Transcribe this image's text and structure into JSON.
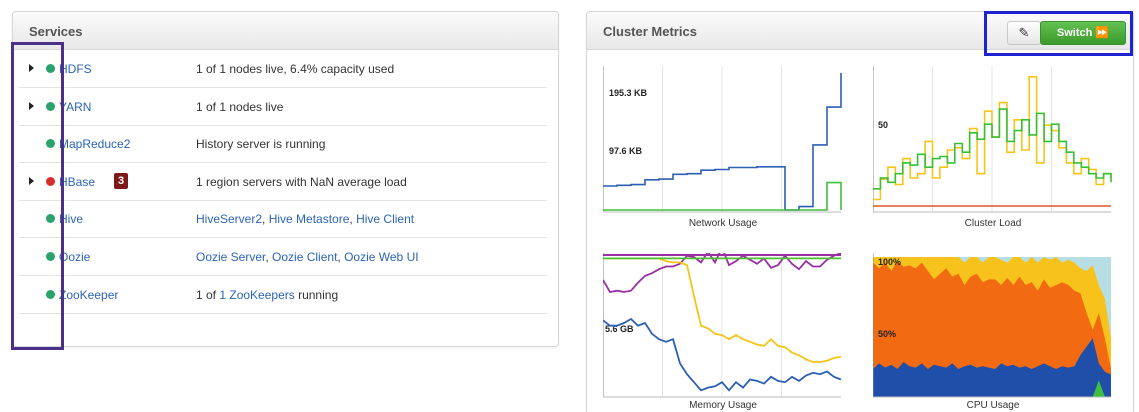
{
  "services_panel": {
    "title": "Services",
    "rows": [
      {
        "name": "HDFS",
        "status_text": "1 of 1 nodes live, 6.4% capacity used",
        "state": "green",
        "expandable": true
      },
      {
        "name": "YARN",
        "status_text": "1 of 1 nodes live",
        "state": "green",
        "expandable": true
      },
      {
        "name": "MapReduce2",
        "status_text": "History server is running",
        "state": "green",
        "expandable": false
      },
      {
        "name": "HBase",
        "alerts": "3",
        "status_text": "1 region servers with NaN average load",
        "state": "red",
        "expandable": true
      },
      {
        "name": "Hive",
        "links": [
          "HiveServer2",
          "Hive Metastore",
          "Hive Client"
        ],
        "link_separator": ", ",
        "state": "green",
        "expandable": false
      },
      {
        "name": "Oozie",
        "links": [
          "Oozie Server",
          "Oozie Client",
          "Oozie Web UI"
        ],
        "link_separator": ", ",
        "state": "green",
        "expandable": false
      },
      {
        "name": "ZooKeeper",
        "status_prefix": "1 of ",
        "status_link": "1 ZooKeepers",
        "status_suffix": " running",
        "state": "green",
        "expandable": false
      }
    ]
  },
  "metrics_panel": {
    "title": "Cluster Metrics",
    "edit_icon": "pencil-icon",
    "switch_label": "Switch ⏩"
  },
  "colors": {
    "status_green": "#2aa36a",
    "status_red": "#d62d2d",
    "link_blue": "#2b64b8",
    "switch_green": "#4bab3c",
    "services_highlight": "#4c2f86",
    "button_highlight": "#1f22d1",
    "net_blue": "#2d5fb5",
    "net_green": "#3fbf3f",
    "load_yellow": "#f5c518",
    "load_green": "#35c035",
    "load_red": "#e0552a",
    "mem_purple": "#9a2fa3",
    "mem_yellow": "#f5c518",
    "mem_blue": "#2d5fb5",
    "mem_green": "#4cbf30",
    "cpu_teal": "#b7dfe3",
    "cpu_yellow": "#f7c21b",
    "cpu_orange": "#f26b12",
    "cpu_blue": "#1f4fa8",
    "cpu_green": "#3fbf3f"
  },
  "chart_data": [
    {
      "type": "line",
      "title": "Network Usage",
      "y_tick_labels": [
        "195.3 KB",
        "97.6 KB"
      ],
      "series": [
        {
          "color": "#2d5fb5",
          "y": [
            35,
            36,
            37,
            44,
            45,
            52,
            53,
            58,
            59,
            62,
            62,
            63,
            63,
            0,
            5,
            95,
            150,
            200
          ]
        },
        {
          "color": "#3fbf3f",
          "y": [
            0,
            0,
            0,
            0,
            0,
            0,
            0,
            0,
            0,
            0,
            0,
            0,
            0,
            0,
            0,
            0,
            40,
            0
          ]
        }
      ]
    },
    {
      "type": "line",
      "title": "Cluster Load",
      "y_tick_labels": [
        "50"
      ],
      "series": [
        {
          "color": "#f5c518",
          "y": [
            6,
            25,
            36,
            20,
            44,
            26,
            30,
            60,
            26,
            36,
            52,
            54,
            44,
            72,
            30,
            88,
            64,
            96,
            50,
            80,
            52,
            120,
            40,
            75,
            70,
            54,
            40,
            30,
            44,
            34,
            20,
            30,
            26
          ]
        },
        {
          "color": "#35c035",
          "y": [
            16,
            26,
            22,
            30,
            40,
            38,
            48,
            36,
            44,
            46,
            40,
            58,
            50,
            68,
            62,
            76,
            64,
            90,
            60,
            70,
            80,
            66,
            86,
            60,
            76,
            60,
            50,
            40,
            36,
            30,
            26,
            30,
            22
          ]
        },
        {
          "color": "#e0552a",
          "y": [
            0,
            0,
            0,
            0,
            0,
            0,
            0,
            0,
            0,
            0,
            0,
            0,
            0,
            0,
            0,
            0,
            0,
            0,
            0,
            0,
            0,
            0,
            0,
            0,
            0,
            0,
            0,
            0,
            0,
            0,
            0,
            0,
            0
          ]
        }
      ]
    },
    {
      "type": "line",
      "title": "Memory Usage",
      "y_tick_labels": [
        "5.6 GB"
      ],
      "series": [
        {
          "color": "#9a2fa3",
          "y": [
            16,
            25,
            24,
            25,
            24,
            18,
            13,
            11,
            8,
            6,
            6,
            4,
            -2,
            -1,
            3,
            -5,
            3,
            -8,
            5,
            2,
            -2,
            1,
            4,
            0,
            7,
            5,
            -2,
            4,
            8,
            2,
            6,
            6,
            1,
            -2,
            -4
          ]
        },
        {
          "color": "#f5c518",
          "y": [
            0,
            0,
            0,
            0,
            0,
            0,
            0,
            0,
            0,
            2,
            3,
            3,
            5,
            28,
            50,
            52,
            56,
            57,
            60,
            57,
            60,
            62,
            64,
            65,
            60,
            65,
            66,
            70,
            72,
            75,
            77,
            77,
            76,
            74,
            73
          ]
        },
        {
          "color": "#2d5fb5",
          "y": [
            46,
            50,
            50,
            48,
            45,
            50,
            48,
            56,
            60,
            62,
            60,
            78,
            86,
            92,
            98,
            96,
            95,
            92,
            98,
            92,
            96,
            90,
            91,
            93,
            88,
            91,
            92,
            88,
            91,
            87,
            85,
            86,
            84,
            88,
            90
          ]
        },
        {
          "color": "#4cbf30",
          "y": [
            0,
            0,
            0,
            0,
            0,
            0,
            0,
            0,
            0,
            0,
            0,
            0,
            0,
            0,
            0,
            0,
            0,
            0,
            0,
            0,
            0,
            0,
            0,
            0,
            0,
            0,
            0,
            0,
            0,
            0,
            0,
            0,
            0,
            0,
            0
          ]
        }
      ]
    },
    {
      "type": "area",
      "title": "CPU Usage",
      "y_tick_labels": [
        "100%",
        "50%"
      ],
      "series": [
        {
          "color": "#1f4fa8",
          "y": [
            20,
            24,
            21,
            23,
            20,
            25,
            22,
            21,
            24,
            20,
            23,
            22,
            21,
            24,
            20,
            22,
            23,
            21,
            22,
            21,
            20,
            24,
            22,
            23,
            21,
            22,
            20,
            22,
            24,
            22,
            20,
            22,
            21,
            22,
            30,
            36,
            42,
            24,
            18,
            16
          ]
        },
        {
          "color": "#f26b12",
          "y": [
            96,
            92,
            96,
            90,
            97,
            93,
            94,
            92,
            96,
            90,
            84,
            88,
            92,
            86,
            88,
            80,
            86,
            88,
            82,
            84,
            84,
            80,
            85,
            80,
            86,
            80,
            82,
            76,
            84,
            78,
            80,
            82,
            80,
            76,
            74,
            60,
            48,
            60,
            42,
            20
          ]
        },
        {
          "color": "#f7c21b",
          "y": [
            100,
            100,
            100,
            100,
            100,
            100,
            100,
            100,
            100,
            100,
            100,
            100,
            100,
            100,
            100,
            96,
            100,
            100,
            96,
            100,
            100,
            98,
            96,
            100,
            100,
            96,
            100,
            96,
            100,
            98,
            100,
            96,
            98,
            96,
            92,
            90,
            94,
            80,
            70,
            42
          ]
        },
        {
          "color": "#b7dfe3",
          "y": [
            100,
            100,
            100,
            100,
            100,
            100,
            100,
            100,
            100,
            100,
            100,
            100,
            100,
            100,
            100,
            100,
            100,
            100,
            100,
            100,
            100,
            100,
            100,
            100,
            100,
            100,
            100,
            100,
            100,
            100,
            100,
            100,
            100,
            100,
            100,
            100,
            100,
            100,
            100,
            100
          ]
        },
        {
          "color": "#3fbf3f",
          "y": [
            0,
            0,
            0,
            0,
            0,
            0,
            0,
            0,
            0,
            0,
            0,
            0,
            0,
            0,
            0,
            0,
            0,
            0,
            0,
            0,
            0,
            0,
            0,
            0,
            0,
            0,
            0,
            0,
            0,
            0,
            0,
            0,
            0,
            0,
            0,
            0,
            0,
            12,
            0,
            0
          ]
        }
      ]
    }
  ]
}
